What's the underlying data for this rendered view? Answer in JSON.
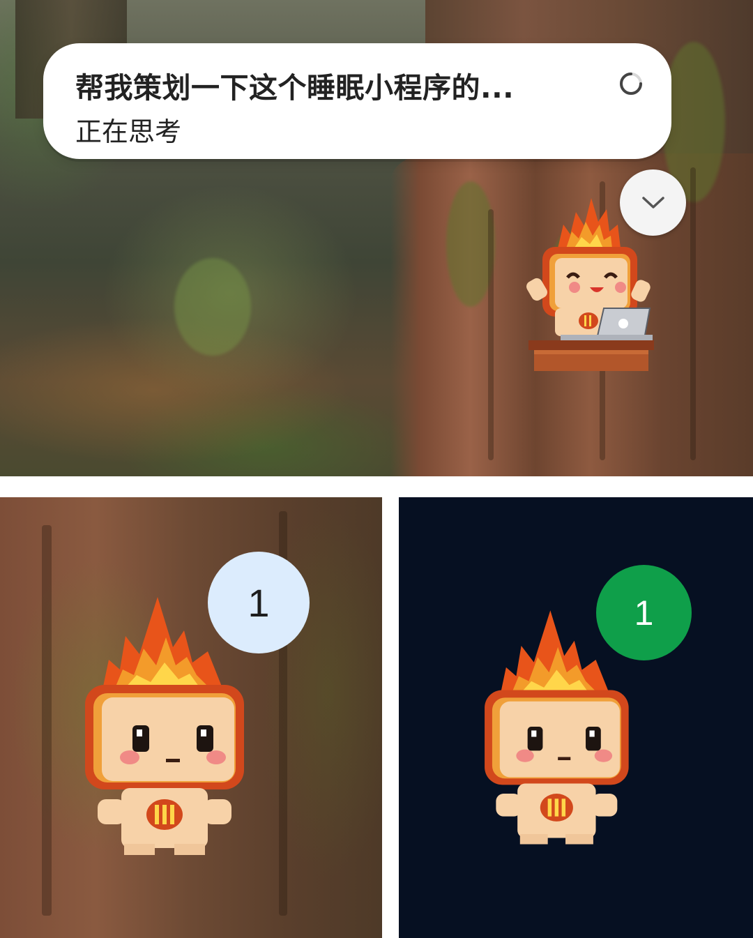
{
  "chat": {
    "title": "帮我策划一下这个睡眠小程序的...",
    "status": "正在思考"
  },
  "icons": {
    "spinner": "loading-spinner-icon",
    "collapse": "chevron-down-icon",
    "mascot": "flame-mascot-icon",
    "laptop": "laptop-icon"
  },
  "badges": {
    "light": {
      "count": "1",
      "color": "#dcecfd"
    },
    "green": {
      "count": "1",
      "color": "#0f9f4a"
    }
  },
  "colors": {
    "dark_panel": "#061022",
    "flame_outer": "#e8541a",
    "flame_inner": "#ffd64a",
    "head_frame": "#d2481c",
    "face": "#f7d2a8"
  }
}
